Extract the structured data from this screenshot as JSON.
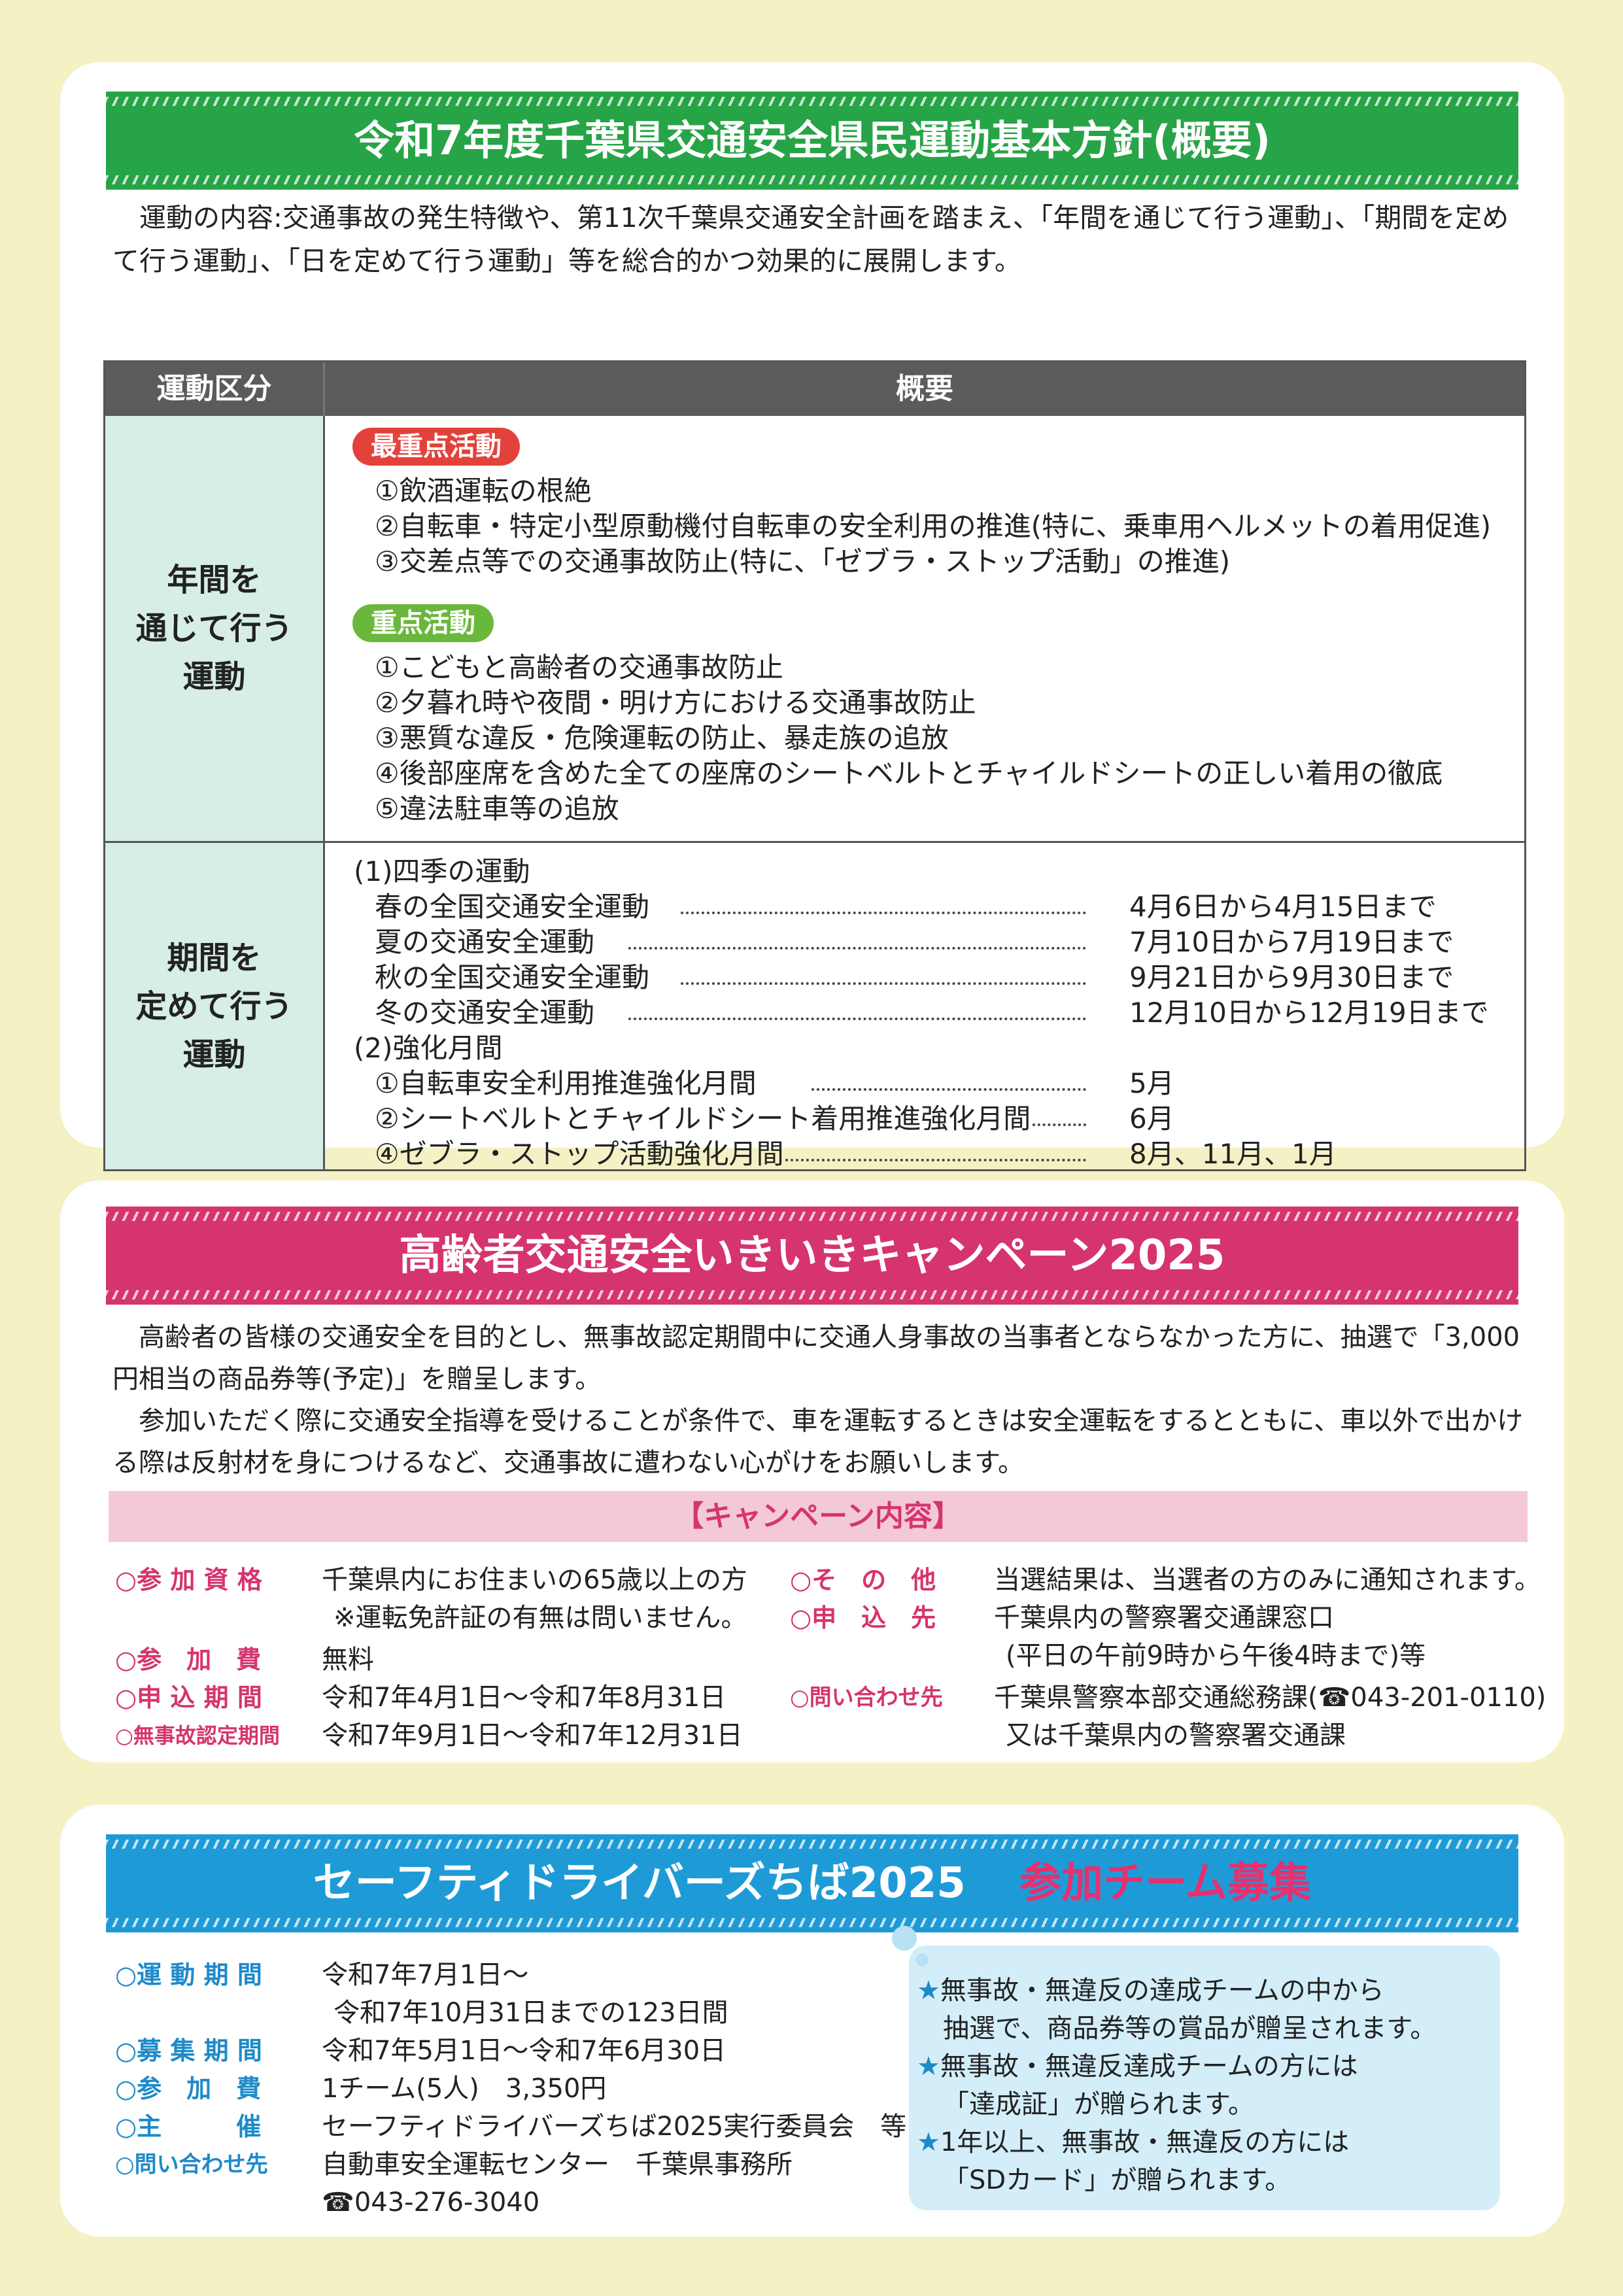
{
  "section1": {
    "title": "令和7年度千葉県交通安全県民運動基本方針(概要)",
    "intro": "運動の内容:交通事故の発生特徴や、第11次千葉県交通安全計画を踏まえ、「年間を通じて行う運動」、「期間を定めて行う運動」、「日を定めて行う運動」等を総合的かつ効果的に展開します。",
    "table": {
      "col1": "運動区分",
      "col2": "概要",
      "row1_label": "年間を\n通じて行う\n運動",
      "top_priority": {
        "tag": "最重点活動",
        "items": [
          "①飲酒運転の根絶",
          "②自転車・特定小型原動機付自転車の安全利用の推進(特に、乗車用ヘルメットの着用促進)",
          "③交差点等での交通事故防止(特に、「ゼブラ・ストップ活動」の推進)"
        ]
      },
      "priority": {
        "tag": "重点活動",
        "items": [
          "①こどもと高齢者の交通事故防止",
          "②夕暮れ時や夜間・明け方における交通事故防止",
          "③悪質な違反・危険運転の防止、暴走族の追放",
          "④後部座席を含めた全ての座席のシートベルトとチャイルドシートの正しい着用の徹底",
          "⑤違法駐車等の追放"
        ]
      },
      "row2_label": "期間を\n定めて行う\n運動",
      "seasonal_heading": "(1)四季の運動",
      "seasonal": [
        {
          "name": "春の全国交通安全運動",
          "period": "4月6日から4月15日まで"
        },
        {
          "name": "夏の交通安全運動",
          "period": "7月10日から7月19日まで"
        },
        {
          "name": "秋の全国交通安全運動",
          "period": "9月21日から9月30日まで"
        },
        {
          "name": "冬の交通安全運動",
          "period": "12月10日から12月19日まで"
        }
      ],
      "months_heading": "(2)強化月間",
      "months": [
        {
          "name": "①自転車安全利用推進強化月間",
          "period": "5月"
        },
        {
          "name": "②シートベルトとチャイルドシート着用推進強化月間",
          "period": "6月"
        },
        {
          "name": "④ゼブラ・ストップ活動強化月間",
          "period": "8月、11月、1月"
        }
      ]
    }
  },
  "section2": {
    "title": "高齢者交通安全いきいきキャンペーン2025",
    "para1": "高齢者の皆様の交通安全を目的とし、無事故認定期間中に交通人身事故の当事者とならなかった方に、抽選で「3,000円相当の商品券等(予定)」を贈呈します。",
    "para2": "参加いただく際に交通安全指導を受けることが条件で、車を運転するときは安全運転をするとともに、車以外で出かける際は反射材を身につけるなど、交通事故に遭わない心がけをお願いします。",
    "subheading": "【キャンペーン内容】",
    "left": [
      {
        "label": "○参 加 資 格",
        "value": "千葉県内にお住まいの65歳以上の方"
      },
      {
        "label": "",
        "value": "※運転免許証の有無は問いません。"
      },
      {
        "label": "○参　加　費",
        "value": "無料"
      },
      {
        "label": "○申 込 期 間",
        "value": "令和7年4月1日～令和7年8月31日"
      },
      {
        "label": "○無事故認定期間",
        "value": "令和7年9月1日～令和7年12月31日"
      }
    ],
    "right": [
      {
        "label": "○そ　の　他",
        "value": "当選結果は、当選者の方のみに通知されます。"
      },
      {
        "label": "○申　込　先",
        "value": "千葉県内の警察署交通課窓口"
      },
      {
        "label": "",
        "value": "(平日の午前9時から午後4時まで)等"
      },
      {
        "label": "○問い合わせ先",
        "value": "千葉県警察本部交通総務課(☎043-201-0110)"
      },
      {
        "label": "",
        "value": "又は千葉県内の警察署交通課"
      }
    ]
  },
  "section3": {
    "title": "セーフティドライバーズちば2025",
    "title_accent": "参加チーム募集",
    "rows": [
      {
        "label": "○運 動 期 間",
        "value": "令和7年7月1日～"
      },
      {
        "label": "",
        "value": "令和7年10月31日までの123日間"
      },
      {
        "label": "○募 集 期 間",
        "value": "令和7年5月1日～令和7年6月30日"
      },
      {
        "label": "○参　加　費",
        "value": "1チーム(5人)　3,350円"
      },
      {
        "label": "○主　　　催",
        "value": "セーフティドライバーズちば2025実行委員会　等"
      },
      {
        "label": "○問い合わせ先",
        "value": "自動車安全運転センター　千葉県事務所"
      },
      {
        "label": "",
        "value": "☎043-276-3040"
      }
    ],
    "bubble": [
      {
        "star": "★",
        "text": "無事故・無違反の達成チームの中から"
      },
      {
        "star": "",
        "text": "抽選で、商品券等の賞品が贈呈されます。"
      },
      {
        "star": "★",
        "text": "無事故・無違反達成チームの方には"
      },
      {
        "star": "",
        "text": "「達成証」が贈られます。"
      },
      {
        "star": "★",
        "text": "1年以上、無事故・無違反の方には"
      },
      {
        "star": "",
        "text": "「SDカード」が贈られます。"
      }
    ]
  },
  "colors": {
    "green": "#27a447",
    "pink": "#d6346e",
    "blue": "#1e9bd7",
    "red_tag": "#e3423a",
    "green_tag": "#69b83c"
  }
}
